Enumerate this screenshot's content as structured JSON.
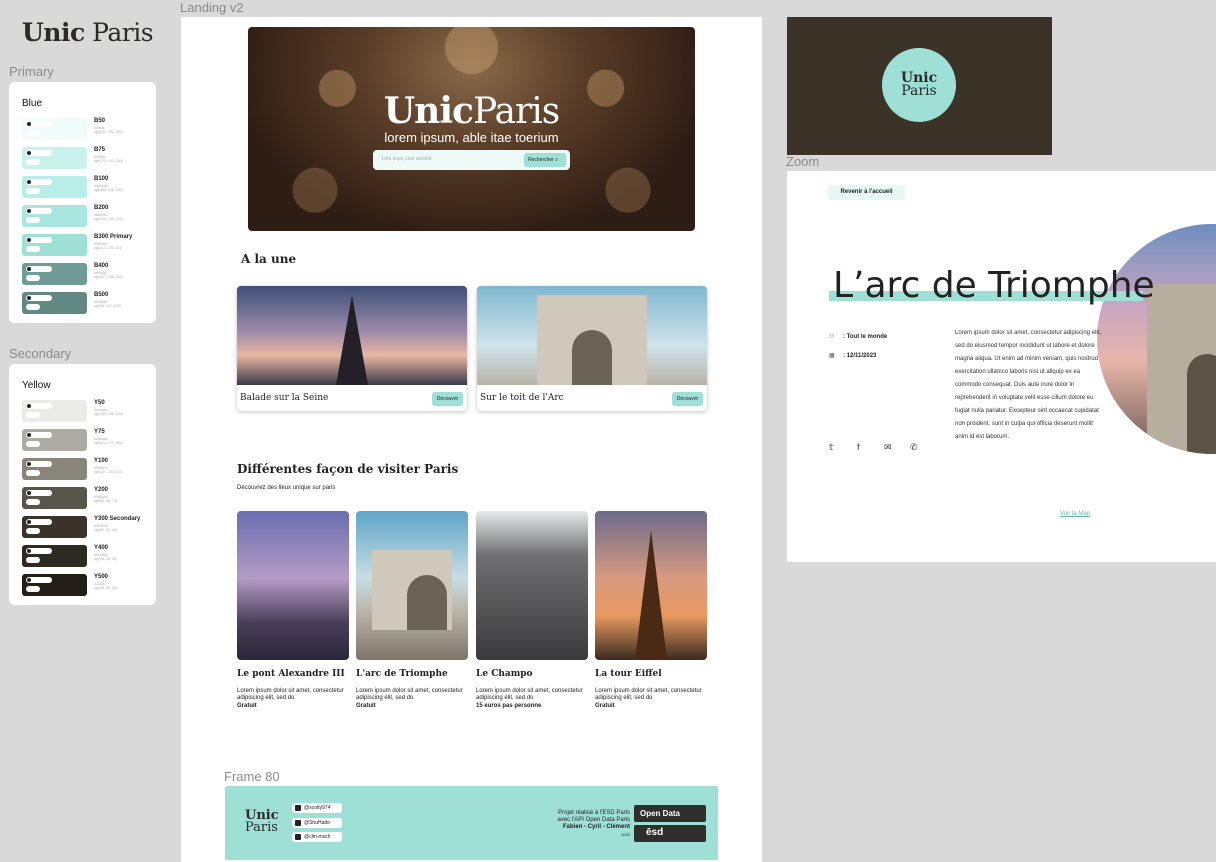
{
  "brand": {
    "bold": "Unic",
    "rest": " Paris"
  },
  "labels": {
    "primary": "Primary",
    "secondary": "Secondary",
    "landing": "Landing v2",
    "zoom": "Zoom",
    "frame80": "Frame 80"
  },
  "primary": {
    "title": "Blue",
    "swatches": [
      {
        "name": "B50",
        "hex": "#f0fcfa",
        "code": "rgb(240, 252, 250)",
        "color": "#f0fcfa",
        "tag": "20.21 AAA ✓✓",
        "sub": "1.04"
      },
      {
        "name": "B75",
        "hex": "#c9f2ec",
        "code": "rgb(173, 242, 236)",
        "color": "#c9f2ec",
        "tag": "17.60 AAA ✓✓",
        "sub": "1.17"
      },
      {
        "name": "B100",
        "hex": "#b2eee8",
        "code": "rgb(156, 236, 230)",
        "color": "#b9ede7",
        "tag": "16.15 AAA ✓✓",
        "sub": "1.26"
      },
      {
        "name": "B200",
        "hex": "#a8e9e2",
        "code": "rgb(140, 230, 223)",
        "color": "#a8e6df",
        "tag": "15.05 AAA ✓✓",
        "sub": "1.36"
      },
      {
        "name": "B300 Primary",
        "hex": "#9fe0d6",
        "code": "rgb(113, 225, 211)",
        "color": "#9fe0d6",
        "tag": "14.12 AAA ✓✓",
        "sub": "1.45"
      },
      {
        "name": "B400",
        "hex": "#6f9c96",
        "code": "rgb(107, 158, 152)",
        "color": "#6f9c96",
        "tag": "6.97 AAA ✓✓",
        "sub": "3.01"
      },
      {
        "name": "B500",
        "hex": "#618882",
        "code": "rgb(96, 137, 130)",
        "color": "#618882",
        "tag": "5.25 AAA ✓✓",
        "sub": "3.92 AA"
      }
    ]
  },
  "secondary": {
    "title": "Yellow",
    "swatches": [
      {
        "name": "Y50",
        "hex": "#ebebea",
        "code": "rgb(235, 235, 234)",
        "color": "#ebebea",
        "tag": "17.50 AAA ✓✓",
        "sub": "1.19"
      },
      {
        "name": "Y75",
        "hex": "#adaba4",
        "code": "rgb(173, 171, 164)",
        "color": "#adaba4",
        "tag": "9.26 AAA ✓✓",
        "sub": "2.27"
      },
      {
        "name": "Y100",
        "hex": "#898579",
        "code": "rgb(137, 133, 121)",
        "color": "#898579",
        "tag": "5.91 AAA ✓✓",
        "sub": "3.55 AA"
      },
      {
        "name": "Y200",
        "hex": "#5a554a",
        "code": "rgb(90, 85, 74)",
        "color": "#5a554a",
        "tag": "2.89",
        "sub": "7.23 AAA ✓✓"
      },
      {
        "name": "Y300 Secondary",
        "hex": "#3b3328",
        "code": "rgb(57, 51, 40)",
        "color": "#3b3328",
        "tag": "1.65",
        "sub": "12.69 AAA ✓✓"
      },
      {
        "name": "Y400",
        "hex": "#2e2a21",
        "code": "rgb(46, 40, 33)",
        "color": "#2e2a21",
        "tag": "1.38",
        "sub": "15.46 AAA ✓✓"
      },
      {
        "name": "Y500",
        "hex": "#231f17",
        "code": "rgb(35, 30, 23)",
        "color": "#231f17",
        "tag": "1.18",
        "sub": "17.88 AAA ✓✓"
      }
    ]
  },
  "hero": {
    "title_bold": "Unic",
    "title_rest": "Paris",
    "subtitle": "lorem ipsum, able itae toerium",
    "search_placeholder": "Une expo, une activité",
    "search_button": "Rechercher"
  },
  "a_la_une": {
    "title": "A la une",
    "cards": [
      {
        "label": "Balade sur la Seine",
        "button": "Découvrir"
      },
      {
        "label": "Sur le toit de l'Arc",
        "button": "Découvrir"
      }
    ]
  },
  "ways": {
    "title": "Différentes façon de visiter Paris",
    "subtitle": "Découvrez des lieux unique sur paris",
    "items": [
      {
        "title": "Le pont Alexandre III",
        "desc": "Lorem ipsum dolor sit amet, consectetur adipiscing elit, sed do",
        "price": "Gratuit"
      },
      {
        "title": "L'arc de Triomphe",
        "desc": "Lorem ipsum dolor sit amet, consectetur adipiscing elit, sed do",
        "price": "Gratuit"
      },
      {
        "title": "Le Champo",
        "desc": "Lorem ipsum dolor sit amet, consectetur adipiscing elit, sed do",
        "price": "15 euros pas personne"
      },
      {
        "title": "La tour Eiffel",
        "desc": "Lorem ipsum dolor sit amet, consectetur adipiscing elit, sed do",
        "price": "Gratuit"
      }
    ]
  },
  "footer": {
    "logo1": "Unic",
    "logo2": "Paris",
    "github": [
      "@scotty974",
      "@ShuHado",
      "@clm-msch"
    ],
    "line1": "Projet réalisé à l'ESD Paris",
    "line2": "avec l'API Open Data Paris",
    "line3": "Fabien - Cyril - Clément",
    "line4": "2023",
    "opendata": "Open Data",
    "esd": "ēsd"
  },
  "logo_frame": {
    "line1": "Unic",
    "line2": "Paris"
  },
  "zoom": {
    "back": "Revenir à l'accueil",
    "title": "L’arc de Triomphe",
    "audience": "Tout le monde",
    "date": "12/11/2023",
    "text": "Lorem ipsum dolor sit amet, consectetur adipiscing elit, sed do eiusmod tempor incididunt ut labore et dolore magna aliqua. Ut enim ad minim veniam, quis nostrud exercitation ullamco laboris nisi ut aliquip ex ea commodo consequat. Duis aute irure dolor in reprehenderit in voluptate velit esse cillum dolore eu fugiat nulla pariatur. Excepteur sint occaecat cupidatat non proident, sunt in culpa qui officia deserunt mollit anim id est laborum.",
    "map_link": "Voir la Map"
  }
}
